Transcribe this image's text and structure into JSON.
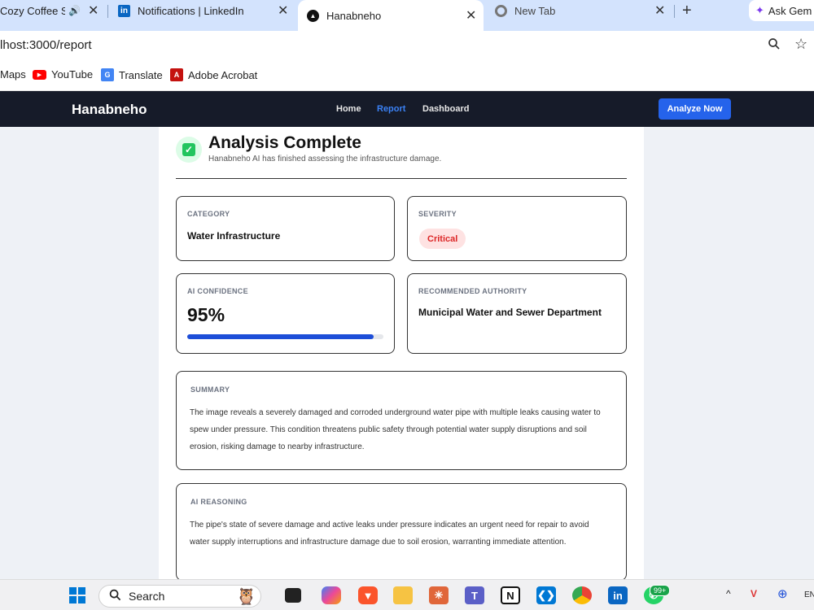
{
  "browser": {
    "tabs": [
      {
        "title": "Cozy Coffee Sh"
      },
      {
        "title": "Notifications | LinkedIn"
      },
      {
        "title": "Hanabneho"
      },
      {
        "title": "New Tab"
      }
    ],
    "gemini_label": "Ask Gem",
    "url": "lhost:3000/report"
  },
  "bookmarks": [
    {
      "label": "Maps"
    },
    {
      "label": "YouTube"
    },
    {
      "label": "Translate"
    },
    {
      "label": "Adobe Acrobat"
    }
  ],
  "app": {
    "brand": "Hanabneho",
    "nav": [
      "Home",
      "Report",
      "Dashboard"
    ],
    "active_nav": "Report",
    "cta_label": "Analyze Now",
    "accent_color": "#2563eb"
  },
  "report": {
    "title": "Analysis Complete",
    "subtitle": "Hanabneho AI has finished assessing the infrastructure damage.",
    "category_label": "CATEGORY",
    "category_value": "Water Infrastructure",
    "severity_label": "SEVERITY",
    "severity_value": "Critical",
    "severity_color": "#dc2626",
    "confidence_label": "AI CONFIDENCE",
    "confidence_value": "95%",
    "confidence_fraction": 0.95,
    "authority_label": "RECOMMENDED AUTHORITY",
    "authority_value": "Municipal Water and Sewer Department",
    "summary_label": "SUMMARY",
    "summary_text": "The image reveals a severely damaged and corroded underground water pipe with multiple leaks causing water to spew under pressure. This condition threatens public safety through potential water supply disruptions and soil erosion, risking damage to nearby infrastructure.",
    "reasoning_label": "AI REASONING",
    "reasoning_text": "The pipe's state of severe damage and active leaks under pressure indicates an urgent need for repair to avoid water supply interruptions and infrastructure damage due to soil erosion, warranting immediate attention."
  },
  "taskbar": {
    "search_label": "Search",
    "whatsapp_badge": "99+",
    "language": "EN"
  }
}
